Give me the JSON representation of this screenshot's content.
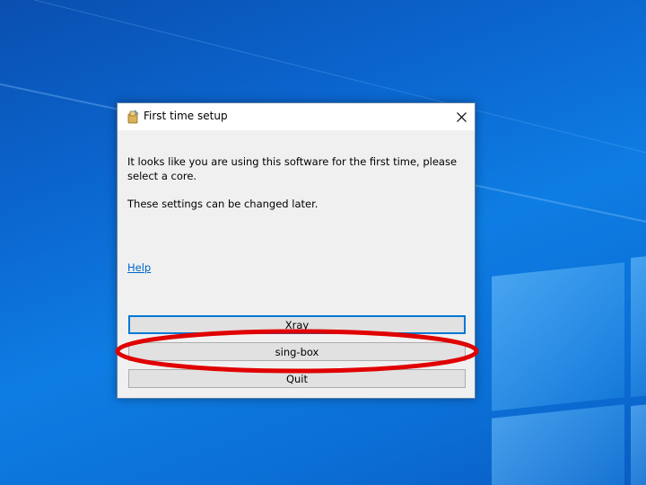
{
  "dialog": {
    "title": "First time setup",
    "message_line": "It looks like you are using this software for the first time, please select a core.",
    "settings_note": "These settings can be changed later.",
    "help_link": "Help",
    "buttons": {
      "xray": "Xray",
      "singbox": "sing-box",
      "quit": "Quit"
    }
  },
  "icons": {
    "app": "app-icon",
    "close": "close-icon"
  },
  "colors": {
    "desktop_blue": "#0b66cf",
    "dialog_bg": "#f0f0f0",
    "focus_border": "#0078d7",
    "link": "#0066cc",
    "annotation_red": "#e00000"
  }
}
